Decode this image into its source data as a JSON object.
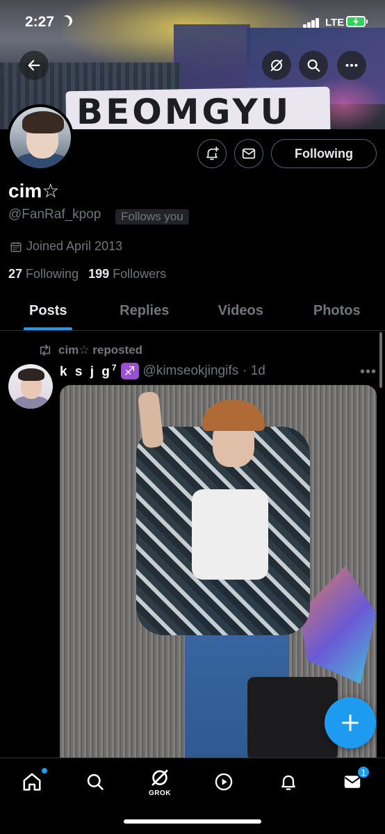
{
  "status_bar": {
    "time": "2:27",
    "network": "LTE"
  },
  "banner": {
    "sign_text": "BEOMGYU"
  },
  "profile": {
    "display_name": "cim☆",
    "handle": "@FanRaf_kpop",
    "follows_you_badge": "Follows you",
    "joined": "Joined April 2013",
    "following_count": "27",
    "following_label": "Following",
    "followers_count": "199",
    "followers_label": "Followers",
    "follow_button_label": "Following"
  },
  "tabs": [
    {
      "label": "Posts",
      "active": true
    },
    {
      "label": "Replies",
      "active": false
    },
    {
      "label": "Videos",
      "active": false
    },
    {
      "label": "Photos",
      "active": false
    }
  ],
  "post": {
    "repost_label": "cim☆ reposted",
    "author_name": "k s j g",
    "author_name_sup": "7",
    "zodiac_icon": "♐",
    "author_handle": "@kimseokjingifs",
    "time": "· 1d"
  },
  "bottom_nav": {
    "grok_label": "GROK",
    "messages_badge": "1",
    "icons": [
      "home-icon",
      "search-icon",
      "grok-icon",
      "play-icon",
      "bell-icon",
      "mail-icon"
    ]
  },
  "colors": {
    "accent": "#1d9bf0",
    "background": "#000000",
    "muted_text": "#71767b",
    "zodiac_bg": "#9b4fd1"
  }
}
